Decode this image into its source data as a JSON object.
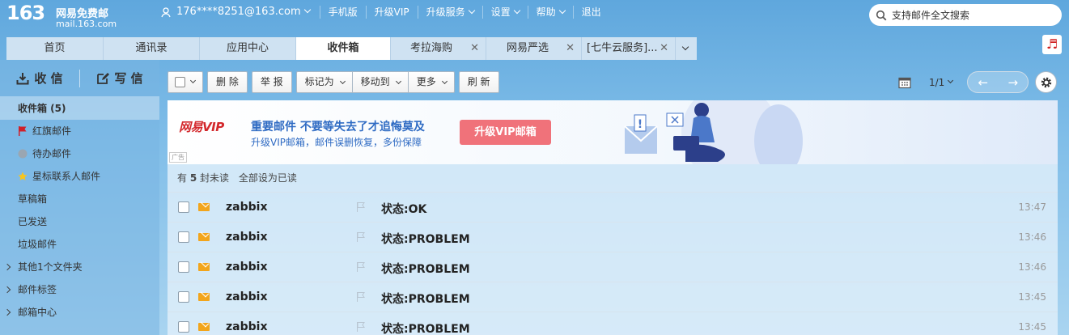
{
  "header": {
    "logo_number": "163",
    "logo_name": "网易免费邮",
    "logo_domain": "mail.163.com",
    "account": "176****8251@163.com",
    "nav": [
      "手机版",
      "升级VIP",
      "升级服务",
      "设置",
      "帮助",
      "退出"
    ],
    "search_placeholder": "支持邮件全文搜索"
  },
  "tabs": [
    {
      "label": "首页"
    },
    {
      "label": "通讯录"
    },
    {
      "label": "应用中心"
    },
    {
      "label": "收件箱",
      "active": true
    },
    {
      "label": "考拉海购",
      "closable": true
    },
    {
      "label": "网易严选",
      "closable": true
    },
    {
      "label": "[七牛云服务]...",
      "closable": true
    }
  ],
  "sidebar": {
    "receive_label": "收 信",
    "compose_label": "写 信",
    "items": [
      {
        "label": "收件箱 (5)"
      },
      {
        "label": "红旗邮件",
        "icon": "red-flag-icon"
      },
      {
        "label": "待办邮件",
        "icon": "todo-dot-icon"
      },
      {
        "label": "星标联系人邮件",
        "icon": "star-icon"
      },
      {
        "label": "草稿箱"
      },
      {
        "label": "已发送"
      },
      {
        "label": "垃圾邮件"
      },
      {
        "label": "其他1个文件夹"
      },
      {
        "label": "邮件标签"
      },
      {
        "label": "邮箱中心"
      }
    ]
  },
  "toolbar": {
    "delete": "删 除",
    "report": "举 报",
    "mark_as": "标记为",
    "move_to": "移动到",
    "more": "更多",
    "refresh": "刷 新",
    "pager": "1/1"
  },
  "ad": {
    "brand": "网易VIP",
    "title": "重要邮件  不要等失去了才追悔莫及",
    "subtitle": "升级VIP邮箱，邮件误删恢复，多份保障",
    "button": "升级VIP邮箱",
    "tag": "广告"
  },
  "unread": {
    "prefix": "有",
    "count": "5",
    "suffix": "封未读",
    "mark_all": "全部设为已读"
  },
  "mails": [
    {
      "sender": "zabbix",
      "subject": "状态:OK",
      "time": "13:47"
    },
    {
      "sender": "zabbix",
      "subject": "状态:PROBLEM",
      "time": "13:46"
    },
    {
      "sender": "zabbix",
      "subject": "状态:PROBLEM",
      "time": "13:46"
    },
    {
      "sender": "zabbix",
      "subject": "状态:PROBLEM",
      "time": "13:45"
    },
    {
      "sender": "zabbix",
      "subject": "状态:PROBLEM",
      "time": "13:45"
    }
  ],
  "colors": {
    "accent": "#5fa7dd",
    "ad_button": "#f0727a",
    "unread_envelope": "#f2a51c",
    "flag_red": "#d0202a"
  }
}
